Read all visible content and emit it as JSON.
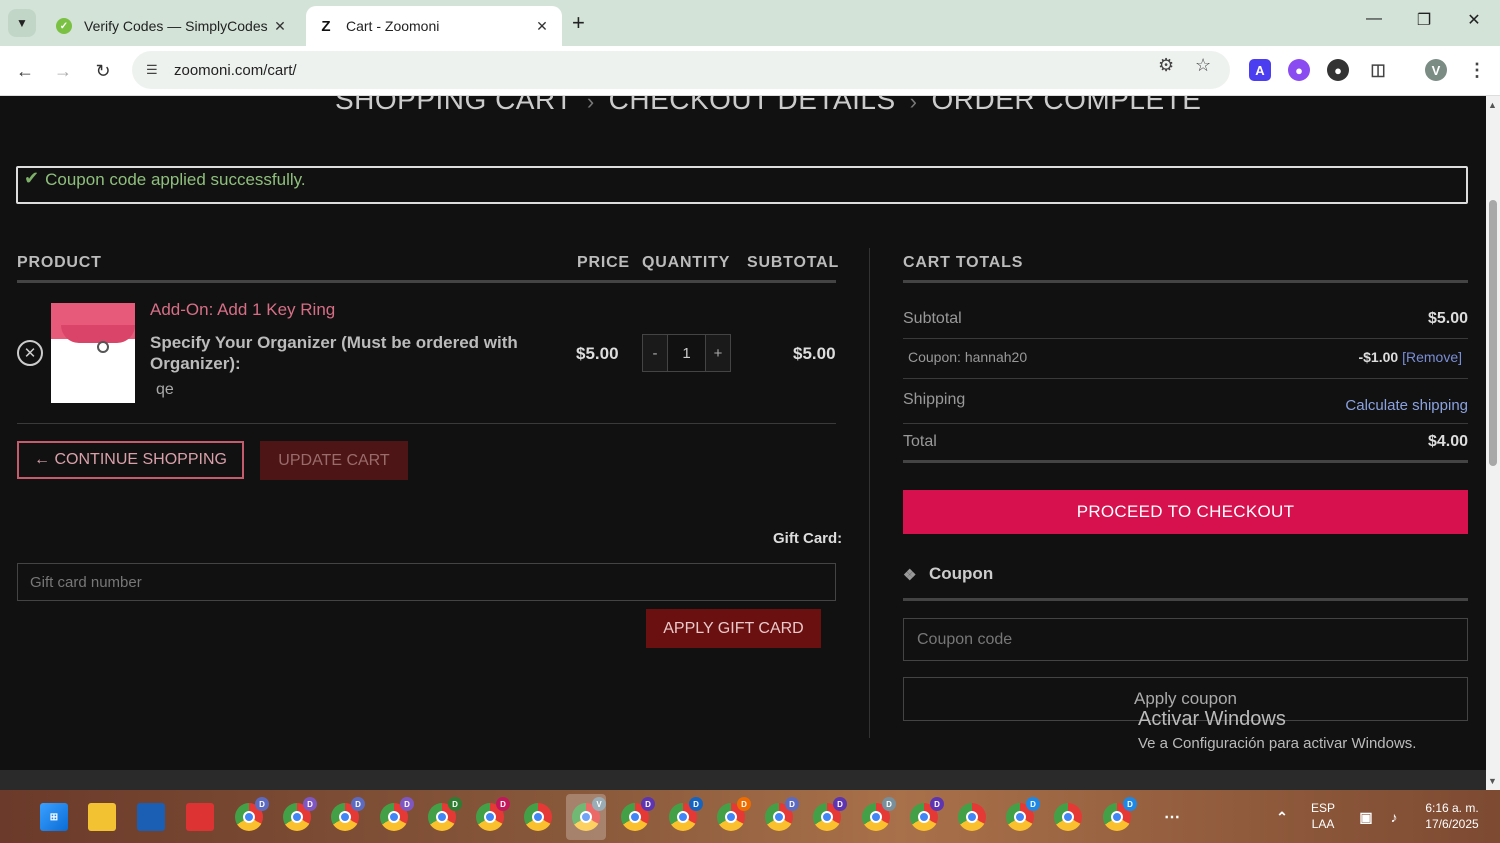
{
  "browser": {
    "tabs": [
      {
        "title": "Verify Codes — SimplyCodes",
        "favicon": "simplycodes-icon"
      },
      {
        "title": "Cart - Zoomoni",
        "favicon": "zoomoni-icon",
        "favicon_char": "Z"
      }
    ],
    "url": "zoomoni.com/cart/",
    "profile_initial": "V"
  },
  "checkout_steps": [
    "SHOPPING CART",
    "CHECKOUT DETAILS",
    "ORDER COMPLETE"
  ],
  "notice": {
    "message": "Coupon code applied successfully."
  },
  "cart_table": {
    "headers": {
      "product": "PRODUCT",
      "price": "PRICE",
      "quantity": "QUANTITY",
      "subtotal": "SUBTOTAL"
    },
    "item": {
      "name": "Add-On: Add 1 Key Ring",
      "option_label": "Specify Your Organizer (Must be ordered with Organizer):",
      "option_value": "qe",
      "price": "$5.00",
      "quantity": "1",
      "qty_minus": "-",
      "qty_plus": "+",
      "subtotal": "$5.00"
    },
    "continue_label": "← CONTINUE SHOPPING",
    "update_label": "UPDATE CART"
  },
  "gift_card": {
    "label": "Gift Card:",
    "placeholder": "Gift card number",
    "apply_label": "APPLY GIFT CARD"
  },
  "cart_totals": {
    "heading": "CART TOTALS",
    "subtotal_label": "Subtotal",
    "subtotal_value": "$5.00",
    "coupon_label": "Coupon: hannah20",
    "coupon_amount": "-$1.00",
    "coupon_remove": "[Remove]",
    "shipping_label": "Shipping",
    "shipping_value": "Calculate shipping",
    "total_label": "Total",
    "total_value": "$4.00",
    "checkout_label": "PROCEED TO CHECKOUT",
    "coupon_heading": "Coupon",
    "coupon_placeholder": "Coupon code",
    "apply_coupon_label": "Apply coupon"
  },
  "watermark": {
    "title": "Activar Windows",
    "subtitle": "Ve a Configuración para activar Windows."
  },
  "taskbar": {
    "lang_1": "ESP",
    "lang_2": "LAA",
    "time": "6:16 a. m.",
    "date": "17/6/2025",
    "badges": [
      "D",
      "D",
      "D",
      "D",
      "D",
      "D",
      "",
      "V",
      "D",
      "D",
      "D",
      "D",
      "D",
      "D",
      "D",
      "",
      "D",
      "",
      "D"
    ]
  },
  "colors": {
    "accent": "#d7104e",
    "success": "#8fbf7d",
    "link": "#8ba2e0",
    "product_link": "#d66f86"
  }
}
